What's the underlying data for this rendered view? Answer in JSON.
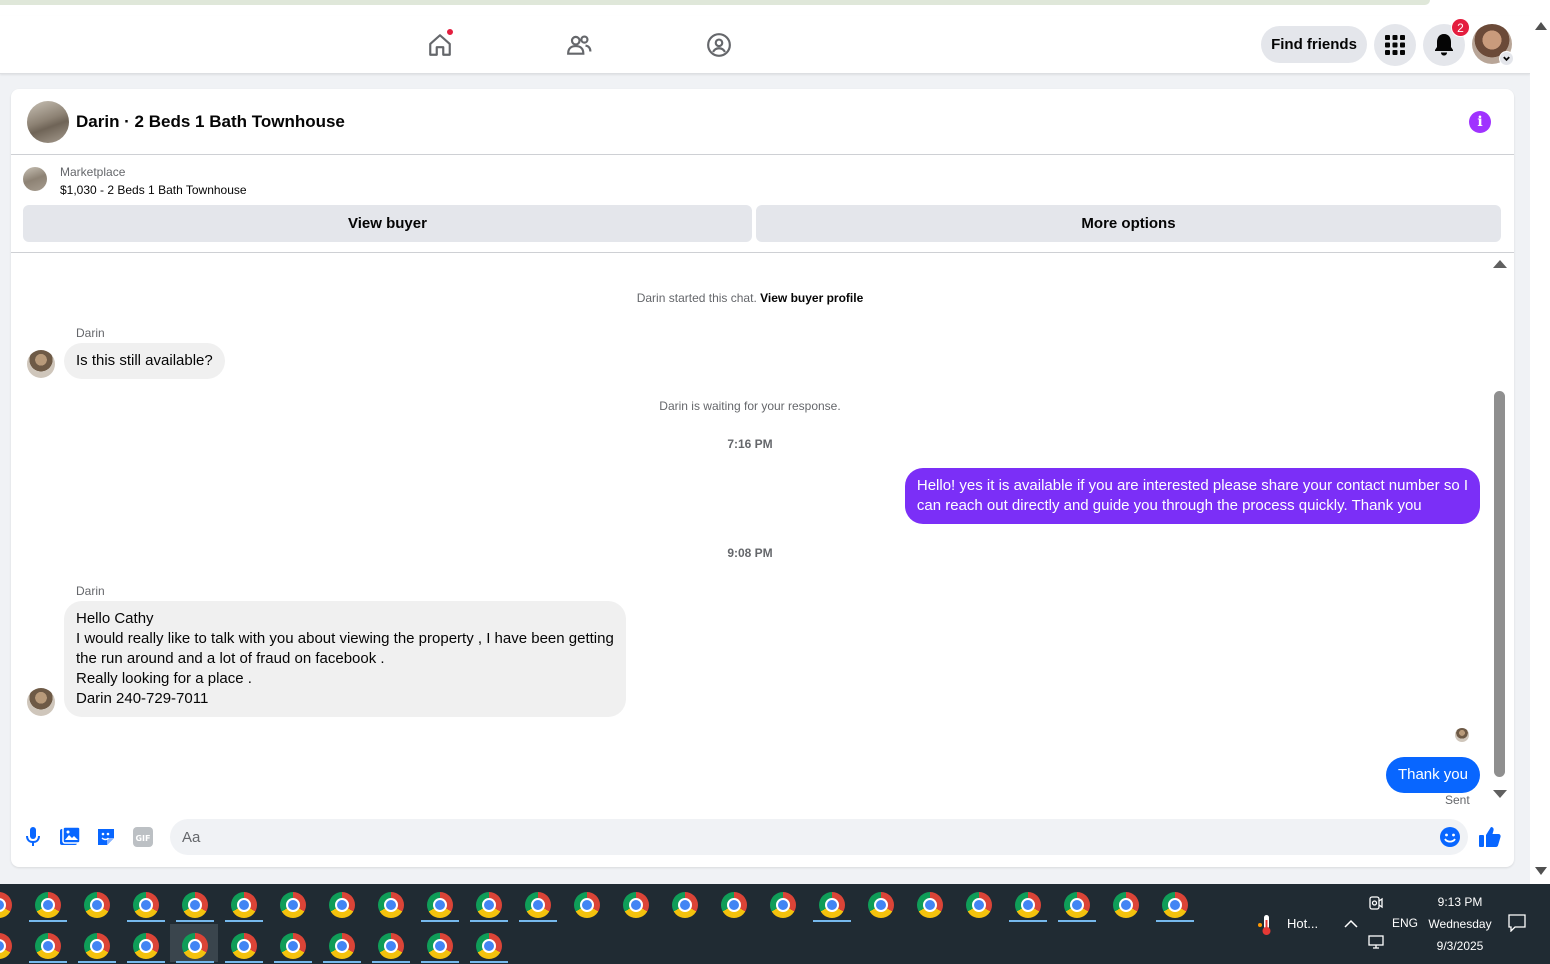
{
  "nav": {
    "find_friends": "Find friends",
    "notification_count": "2"
  },
  "chat": {
    "title": "Darin · 2 Beds 1 Bath Townhouse",
    "listing_source": "Marketplace",
    "listing_name": "$1,030 - 2 Beds 1 Bath Townhouse",
    "view_buyer": "View buyer",
    "more_options": "More options"
  },
  "messages": {
    "started_text": "Darin started this chat.",
    "started_link": "View buyer profile",
    "sender1": "Darin",
    "msg1": "Is this still available?",
    "waiting": "Darin is waiting for your response.",
    "time1": "7:16 PM",
    "out1_line1": "Hello! yes it is available if you are interested please share your contact number so I",
    "out1_line2": "can reach out directly and guide you through the process quickly. Thank you",
    "out1_color": "#7b2ff7",
    "time2": "9:08 PM",
    "sender2": "Darin",
    "msg2_lines": [
      "Hello  Cathy",
      "I would really like to talk with you about viewing the property , I have been getting",
      "the run around and a lot of fraud on facebook .",
      "Really looking for a place .",
      "Darin 240-729-7011"
    ],
    "out2": "Thank you",
    "out2_color": "#0866ff",
    "sent_status": "Sent"
  },
  "composer": {
    "placeholder": "Aa",
    "icons": [
      "microphone-icon",
      "image-icon",
      "sticker-icon",
      "gif-icon",
      "emoji-icon",
      "thumbs-up-icon"
    ],
    "accent": "#0866ff"
  },
  "taskbar": {
    "weather": "Hot...",
    "language": "ENG",
    "time": "9:13 PM",
    "day": "Wednesday",
    "date": "9/3/2025"
  }
}
